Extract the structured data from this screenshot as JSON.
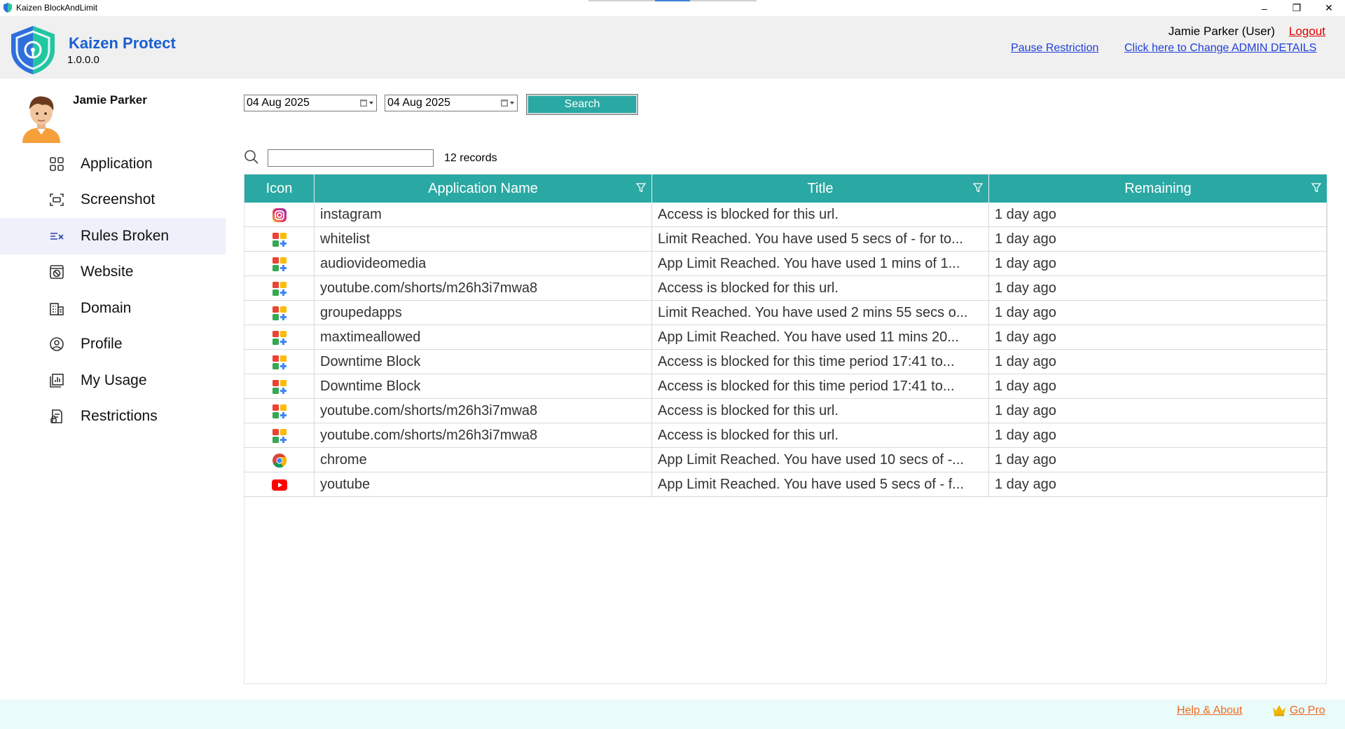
{
  "window": {
    "title": "Kaizen BlockAndLimit",
    "minimize": "–",
    "maximize": "❐",
    "close": "✕"
  },
  "header": {
    "brand_name": "Kaizen Protect",
    "version": "1.0.0.0",
    "user_info": "Jamie Parker (User)",
    "logout": "Logout",
    "pause_restriction": "Pause Restriction",
    "change_admin": "Click here to Change ADMIN DETAILS"
  },
  "sidebar": {
    "profile_name": "Jamie Parker",
    "items": [
      {
        "label": "Application",
        "icon": "grid-icon",
        "active": false
      },
      {
        "label": "Screenshot",
        "icon": "screenshot-icon",
        "active": false
      },
      {
        "label": "Rules Broken",
        "icon": "rules-broken-icon",
        "active": true
      },
      {
        "label": "Website",
        "icon": "website-block-icon",
        "active": false
      },
      {
        "label": "Domain",
        "icon": "domain-icon",
        "active": false
      },
      {
        "label": "Profile",
        "icon": "profile-icon",
        "active": false
      },
      {
        "label": "My Usage",
        "icon": "usage-icon",
        "active": false
      },
      {
        "label": "Restrictions",
        "icon": "restrictions-icon",
        "active": false
      }
    ]
  },
  "toolbar": {
    "date_from": "04 Aug 2025",
    "date_to": "04 Aug 2025",
    "search_label": "Search",
    "filter_value": "",
    "record_count": "12 records"
  },
  "table": {
    "columns": [
      "Icon",
      "Application Name",
      "Title",
      "Remaining"
    ],
    "rows": [
      {
        "icon": "instagram",
        "app": "instagram",
        "title": "Access is blocked for this url.",
        "remaining": "1 day ago"
      },
      {
        "icon": "generic-app",
        "app": "whitelist",
        "title": "Limit Reached. You have used 5 secs of - for to...",
        "remaining": "1 day ago"
      },
      {
        "icon": "generic-app",
        "app": "audiovideomedia",
        "title": "App Limit Reached. You have used 1 mins of 1...",
        "remaining": "1 day ago"
      },
      {
        "icon": "generic-app",
        "app": "youtube.com/shorts/m26h3i7mwa8",
        "title": "Access is blocked for this url.",
        "remaining": "1 day ago"
      },
      {
        "icon": "generic-app",
        "app": "groupedapps",
        "title": "Limit Reached. You have used 2 mins 55 secs o...",
        "remaining": "1 day ago"
      },
      {
        "icon": "generic-app",
        "app": "maxtimeallowed",
        "title": "App Limit Reached. You have used 11 mins 20...",
        "remaining": "1 day ago"
      },
      {
        "icon": "generic-app",
        "app": "Downtime Block",
        "title": "Access is blocked for this time period 17:41 to...",
        "remaining": "1 day ago"
      },
      {
        "icon": "generic-app",
        "app": "Downtime Block",
        "title": "Access is blocked for this time period 17:41 to...",
        "remaining": "1 day ago"
      },
      {
        "icon": "generic-app",
        "app": "youtube.com/shorts/m26h3i7mwa8",
        "title": "Access is blocked for this url.",
        "remaining": "1 day ago"
      },
      {
        "icon": "generic-app",
        "app": "youtube.com/shorts/m26h3i7mwa8",
        "title": "Access is blocked for this url.",
        "remaining": "1 day ago"
      },
      {
        "icon": "chrome",
        "app": "chrome",
        "title": "App Limit Reached. You have used 10 secs of -...",
        "remaining": "1 day ago"
      },
      {
        "icon": "youtube",
        "app": "youtube",
        "title": "App Limit Reached. You have used 5 secs of - f...",
        "remaining": "1 day ago"
      }
    ]
  },
  "footer": {
    "help_about": "Help & About",
    "go_pro": "Go Pro"
  },
  "colors": {
    "accent": "#2aa8a3",
    "brand": "#1a5fd0",
    "link": "#1f3fd8",
    "logout": "#e00000",
    "footer_link": "#f06a1f"
  }
}
